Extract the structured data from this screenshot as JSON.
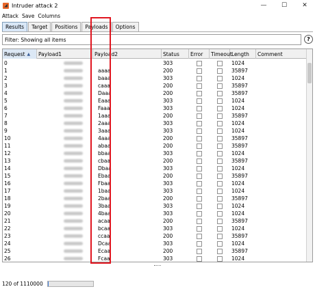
{
  "window": {
    "title": "Intruder attack 2",
    "controls": [
      "—",
      "☐",
      "✕"
    ]
  },
  "menu": [
    "Attack",
    "Save",
    "Columns"
  ],
  "tabs": [
    {
      "label": "Results",
      "active": true
    },
    {
      "label": "Target",
      "active": false
    },
    {
      "label": "Positions",
      "active": false
    },
    {
      "label": "Payloads",
      "active": false
    },
    {
      "label": "Options",
      "active": false
    }
  ],
  "filter": {
    "text": "Filter: Showing all items",
    "help_label": "?"
  },
  "table": {
    "columns": [
      "Request",
      "Payload1",
      "Payload2",
      "Status",
      "Error",
      "Timeout",
      "Length",
      "Comment"
    ],
    "sort_indicator": "▲",
    "rows": [
      {
        "request": "0",
        "payload2": "",
        "status": "303",
        "length": "1024"
      },
      {
        "request": "1",
        "payload2": "aaaa",
        "status": "200",
        "length": "35897"
      },
      {
        "request": "2",
        "payload2": "baaa",
        "status": "303",
        "length": "1024"
      },
      {
        "request": "3",
        "payload2": "caaa",
        "status": "200",
        "length": "35897"
      },
      {
        "request": "4",
        "payload2": "Daaa",
        "status": "200",
        "length": "35897"
      },
      {
        "request": "5",
        "payload2": "Eaaa",
        "status": "303",
        "length": "1024"
      },
      {
        "request": "6",
        "payload2": "Faaa",
        "status": "303",
        "length": "1024"
      },
      {
        "request": "7",
        "payload2": "1aaa",
        "status": "200",
        "length": "35897"
      },
      {
        "request": "8",
        "payload2": "2aaa",
        "status": "303",
        "length": "1024"
      },
      {
        "request": "9",
        "payload2": "3aaa",
        "status": "303",
        "length": "1024"
      },
      {
        "request": "10",
        "payload2": "4aaa",
        "status": "200",
        "length": "35897"
      },
      {
        "request": "11",
        "payload2": "abaa",
        "status": "200",
        "length": "35897"
      },
      {
        "request": "12",
        "payload2": "bbaa",
        "status": "303",
        "length": "1024"
      },
      {
        "request": "13",
        "payload2": "cbaa",
        "status": "200",
        "length": "35897"
      },
      {
        "request": "14",
        "payload2": "Dbaa",
        "status": "303",
        "length": "1024"
      },
      {
        "request": "15",
        "payload2": "Ebaa",
        "status": "200",
        "length": "35897"
      },
      {
        "request": "16",
        "payload2": "Fbaa",
        "status": "303",
        "length": "1024"
      },
      {
        "request": "17",
        "payload2": "1baa",
        "status": "303",
        "length": "1024"
      },
      {
        "request": "18",
        "payload2": "2baa",
        "status": "200",
        "length": "35897"
      },
      {
        "request": "19",
        "payload2": "3baa",
        "status": "303",
        "length": "1024"
      },
      {
        "request": "20",
        "payload2": "4baa",
        "status": "303",
        "length": "1024"
      },
      {
        "request": "21",
        "payload2": "acaa",
        "status": "200",
        "length": "35897"
      },
      {
        "request": "22",
        "payload2": "bcaa",
        "status": "303",
        "length": "1024"
      },
      {
        "request": "23",
        "payload2": "ccaa",
        "status": "200",
        "length": "35897"
      },
      {
        "request": "24",
        "payload2": "Dcaa",
        "status": "303",
        "length": "1024"
      },
      {
        "request": "25",
        "payload2": "Ecaa",
        "status": "200",
        "length": "35897"
      },
      {
        "request": "26",
        "payload2": "Fcaa",
        "status": "303",
        "length": "1024"
      }
    ]
  },
  "highlight_color": "#e0141e",
  "status_bar": {
    "progress_text": "120 of 1110000",
    "progress_fraction": 0.0001
  }
}
